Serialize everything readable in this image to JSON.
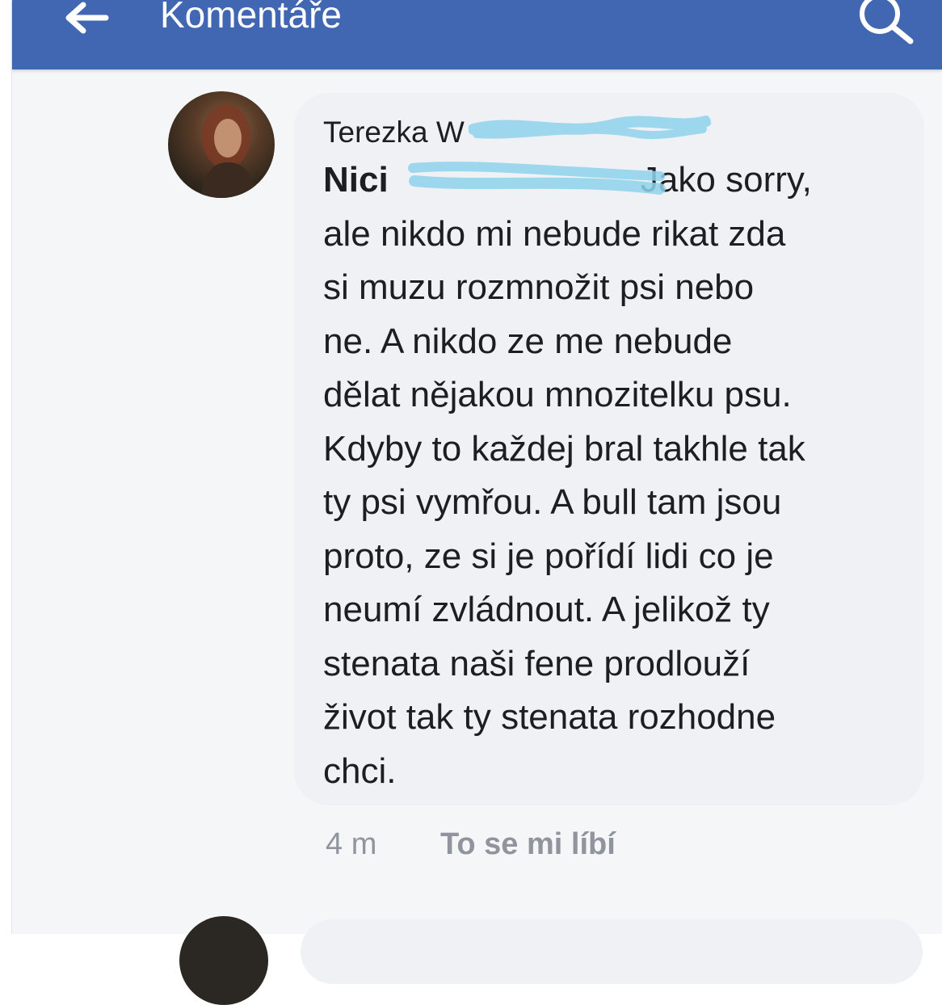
{
  "header": {
    "title": "Komentáře",
    "back_icon": "arrow-left-icon",
    "search_icon": "search-icon",
    "bg_color": "#4267b2"
  },
  "comment": {
    "author": "Terezka W",
    "mention": "Nici",
    "lines": [
      " Jako sorry,",
      "ale nikdo mi nebude rikat zda",
      "si muzu rozmnožit psi nebo",
      "ne. A nikdo ze me nebude",
      "dělat nějakou mnozitelku psu.",
      "Kdyby to každej bral takhle tak",
      "ty psi vymřou. A bull tam jsou",
      "proto, ze si je pořídí lidi co je",
      "neumí zvládnout. A jelikož ty",
      "stenata naši fene prodlouží",
      "život tak ty stenata rozhodne",
      "chci."
    ],
    "time": "4 m",
    "like_label": "To se mi líbí"
  }
}
